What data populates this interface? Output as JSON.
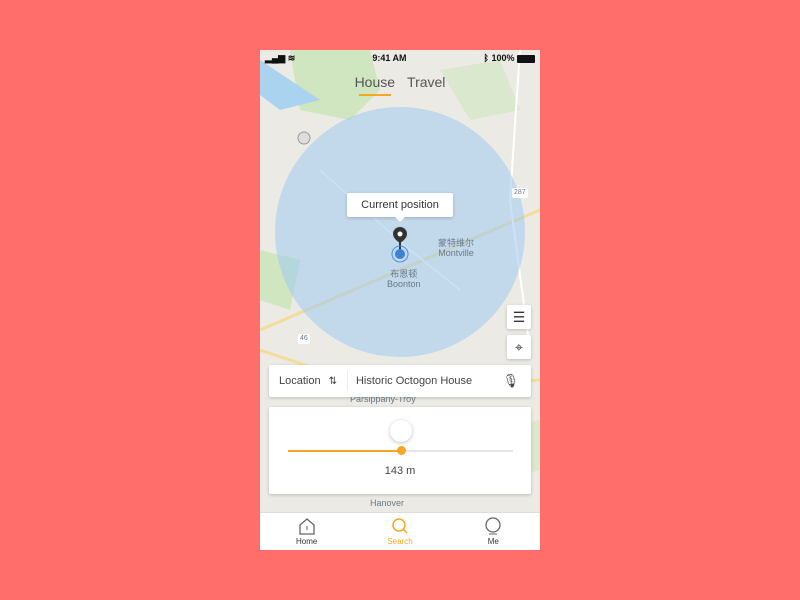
{
  "status": {
    "time": "9:41 AM",
    "battery": "100%"
  },
  "tabs": [
    {
      "label": "House",
      "active": true
    },
    {
      "label": "Travel",
      "active": false
    }
  ],
  "map": {
    "tooltip": "Current position",
    "labels": {
      "montville_cn": "蒙特维尔",
      "montville": "Montville",
      "boonton_cn": "布恩顿",
      "boonton": "Boonton",
      "parsippany": "Parsippany-Troy",
      "hanover": "Hanover",
      "route287": "287",
      "route46": "46"
    }
  },
  "search": {
    "location_label": "Location",
    "query": "Historic Octogon House"
  },
  "radius": {
    "value_label": "143 m",
    "fraction": 0.5
  },
  "nav": [
    {
      "label": "Home"
    },
    {
      "label": "Search",
      "active": true
    },
    {
      "label": "Me"
    }
  ],
  "colors": {
    "accent": "#f5a623",
    "background": "#ff6e6b"
  }
}
